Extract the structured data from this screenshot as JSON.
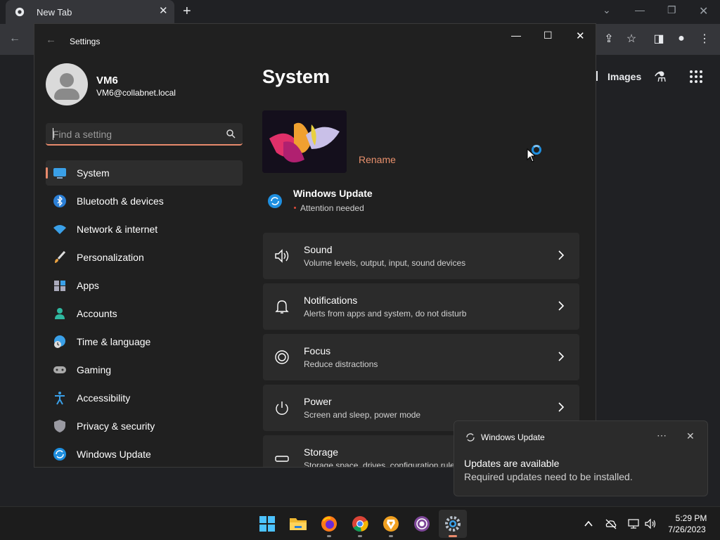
{
  "browser": {
    "tab_title": "New Tab",
    "google_images_link": "Images"
  },
  "settings": {
    "window_title": "Settings",
    "user": {
      "name": "VM6",
      "email": "VM6@collabnet.local"
    },
    "search": {
      "placeholder": "Find a setting",
      "value": ""
    },
    "nav": [
      {
        "label": "System",
        "icon": "monitor-icon",
        "active": true
      },
      {
        "label": "Bluetooth & devices",
        "icon": "bluetooth-icon"
      },
      {
        "label": "Network & internet",
        "icon": "wifi-icon"
      },
      {
        "label": "Personalization",
        "icon": "brush-icon"
      },
      {
        "label": "Apps",
        "icon": "apps-icon"
      },
      {
        "label": "Accounts",
        "icon": "person-icon"
      },
      {
        "label": "Time & language",
        "icon": "globe-clock-icon"
      },
      {
        "label": "Gaming",
        "icon": "gamepad-icon"
      },
      {
        "label": "Accessibility",
        "icon": "accessibility-icon"
      },
      {
        "label": "Privacy & security",
        "icon": "shield-icon"
      },
      {
        "label": "Windows Update",
        "icon": "sync-icon"
      }
    ],
    "page_title": "System",
    "rename_label": "Rename",
    "update_banner": {
      "title": "Windows Update",
      "status": "Attention needed"
    },
    "cards": [
      {
        "title": "Sound",
        "desc": "Volume levels, output, input, sound devices",
        "icon": "speaker-icon"
      },
      {
        "title": "Notifications",
        "desc": "Alerts from apps and system, do not disturb",
        "icon": "bell-icon"
      },
      {
        "title": "Focus",
        "desc": "Reduce distractions",
        "icon": "focus-icon"
      },
      {
        "title": "Power",
        "desc": "Screen and sleep, power mode",
        "icon": "power-icon"
      },
      {
        "title": "Storage",
        "desc": "Storage space, drives, configuration rules",
        "icon": "drive-icon"
      }
    ]
  },
  "toast": {
    "app": "Windows Update",
    "heading": "Updates are available",
    "body": "Required updates need to be installed."
  },
  "taskbar": {
    "apps": [
      "start-icon",
      "file-explorer-icon",
      "firefox-icon",
      "chrome-icon",
      "brave-icon",
      "tor-browser-icon",
      "settings-icon"
    ],
    "time": "5:29 PM",
    "date": "7/26/2023"
  },
  "colors": {
    "accent": "#e88a6c",
    "background": "#202020",
    "card": "#2b2b2b"
  }
}
